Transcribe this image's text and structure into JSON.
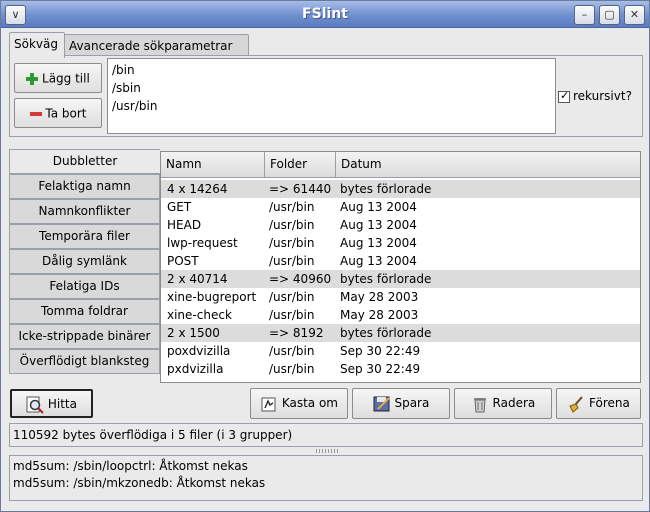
{
  "window": {
    "title": "FSlint",
    "menu_glyph": "∨",
    "min_glyph": "–",
    "max_glyph": "▢",
    "close_glyph": "✕"
  },
  "tabs": [
    {
      "label": "Sökväg"
    },
    {
      "label": "Avancerade sökparametrar"
    }
  ],
  "search": {
    "add_label": "Lägg till",
    "remove_label": "Ta bort",
    "paths": [
      "/bin",
      "/sbin",
      "/usr/bin"
    ],
    "recursive_label": "rekursivt?"
  },
  "categories": [
    {
      "label": "Dubbletter"
    },
    {
      "label": "Felaktiga namn"
    },
    {
      "label": "Namnkonflikter"
    },
    {
      "label": "Temporära filer"
    },
    {
      "label": "Dålig symlänk"
    },
    {
      "label": "Felatiga IDs"
    },
    {
      "label": "Tomma foldrar"
    },
    {
      "label": "Icke-strippade binärer"
    },
    {
      "label": "Överflödigt blanksteg"
    }
  ],
  "table": {
    "headers": [
      "Namn",
      "Folder",
      "Datum"
    ],
    "rows": [
      {
        "group": true,
        "c1": "4 x 14264",
        "c2": "=> 61440",
        "c3": "bytes förlorade"
      },
      {
        "group": false,
        "c1": "GET",
        "c2": "/usr/bin",
        "c3": "Aug 13 2004"
      },
      {
        "group": false,
        "c1": "HEAD",
        "c2": "/usr/bin",
        "c3": "Aug 13 2004"
      },
      {
        "group": false,
        "c1": "lwp-request",
        "c2": "/usr/bin",
        "c3": "Aug 13 2004"
      },
      {
        "group": false,
        "c1": "POST",
        "c2": "/usr/bin",
        "c3": "Aug 13 2004"
      },
      {
        "group": true,
        "c1": "2 x 40714",
        "c2": "=> 40960",
        "c3": "bytes förlorade"
      },
      {
        "group": false,
        "c1": "xine-bugreport",
        "c2": "/usr/bin",
        "c3": "May 28 2003"
      },
      {
        "group": false,
        "c1": "xine-check",
        "c2": "/usr/bin",
        "c3": "May 28 2003"
      },
      {
        "group": true,
        "c1": "2 x 1500",
        "c2": "=> 8192",
        "c3": "bytes förlorade"
      },
      {
        "group": false,
        "c1": "poxdvizilla",
        "c2": "/usr/bin",
        "c3": "Sep 30 22:49"
      },
      {
        "group": false,
        "c1": "pxdvizilla",
        "c2": "/usr/bin",
        "c3": "Sep 30 22:49"
      }
    ]
  },
  "actions": {
    "find": "Hitta",
    "invert": "Kasta om",
    "save": "Spara",
    "delete": "Radera",
    "merge": "Förena"
  },
  "status": "110592 bytes överflödiga i 5 filer (i 3 grupper)",
  "log": [
    "md5sum: /sbin/loopctrl: Åtkomst nekas",
    "md5sum: /sbin/mkzonedb: Åtkomst nekas"
  ]
}
